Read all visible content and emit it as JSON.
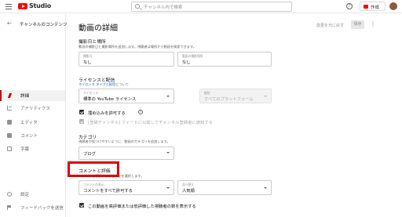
{
  "topbar": {
    "brand": "Studio",
    "search_placeholder": "チャンネル内で検索",
    "help_glyph": "?",
    "create_label": "作成"
  },
  "sidebar": {
    "channel_title": "チャンネルのコンテンツ",
    "items": [
      {
        "label": "詳細",
        "icon": "pencil-icon",
        "active": true
      },
      {
        "label": "アナリティクス",
        "icon": "analytics-icon"
      },
      {
        "label": "エディタ",
        "icon": "film-icon"
      },
      {
        "label": "コメント",
        "icon": "comment-icon"
      },
      {
        "label": "字幕",
        "icon": "subtitles-icon"
      }
    ],
    "footer": [
      {
        "label": "設定",
        "icon": "gear-icon"
      },
      {
        "label": "フィードバックを送信",
        "icon": "flag-icon"
      }
    ]
  },
  "main": {
    "title": "動画の詳細",
    "undo_label": "変更を元に戻す",
    "save_label": "保存",
    "recording": {
      "heading": "撮影日と場所",
      "subtitle": "動画の撮影日と撮影場所を追加します。視聴者は場所から動画を検索できます。",
      "date_label": "撮影日",
      "date_value": "なし",
      "location_label": "動画の撮影場所",
      "location_value": "なし"
    },
    "license": {
      "heading": "ライセンスと配信",
      "subtitle_link": "ライセンス タイプと配信",
      "subtitle_rest": "について",
      "license_label": "ライセンス",
      "license_value": "標準の YouTube ライセンス",
      "distribution_label": "配信",
      "distribution_value": "すべてのプラットフォーム",
      "embed_label": "埋め込みを許可する",
      "info_glyph": "?",
      "notify_label": "[登録チャンネル] フィードに公開してチャンネル登録者に通知する"
    },
    "category": {
      "heading": "カテゴリ",
      "subtitle": "視聴者が見つけやすいように、動画のカテゴリを追加します。",
      "value": "ブログ"
    },
    "comments": {
      "heading": "コメントと評価",
      "subtitle": "コメントを表示するかどうかを選択します。",
      "visibility_label": "コメントの表示",
      "visibility_value": "コメントをすべて許可する",
      "sort_label": "並べ替え",
      "sort_value": "人気順",
      "ratings_label": "この動画を高評価または低評価した視聴者の数を表示する"
    }
  },
  "colors": {
    "accent": "#cc0000",
    "link": "#065fd4",
    "highlight_box": "#e00000"
  }
}
